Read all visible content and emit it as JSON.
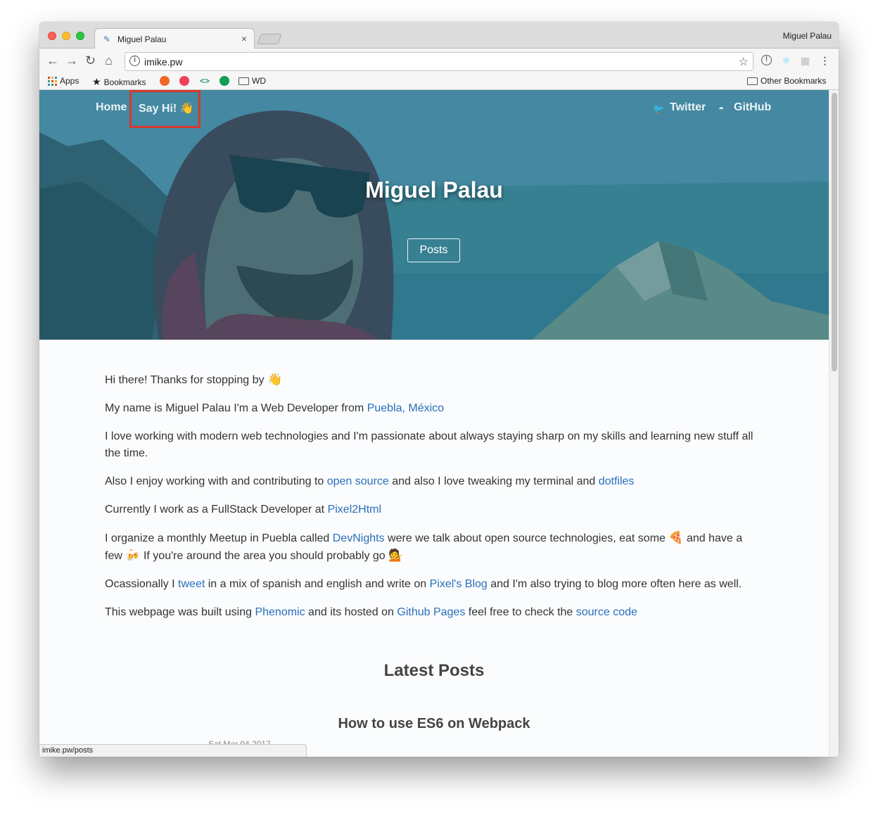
{
  "browser": {
    "tab_title": "Miguel Palau",
    "profile_name": "Miguel Palau",
    "url": "imike.pw",
    "status_url": "imike.pw/posts"
  },
  "bookmarks": {
    "apps_label": "Apps",
    "bookmarks_label": "Bookmarks",
    "wd_label": "WD",
    "other_label": "Other Bookmarks"
  },
  "nav": {
    "home": "Home",
    "say_hi": "Say Hi! 👋",
    "twitter": "Twitter",
    "github": "GitHub"
  },
  "hero": {
    "title": "Miguel Palau",
    "button": "Posts"
  },
  "about": {
    "p1": "Hi there! Thanks for stopping by",
    "p1_emoji": "👋",
    "p2_text": "My name is Miguel Palau I'm a Web Developer from ",
    "p2_link": "Puebla, México",
    "p3": "I love working with modern web technologies and I'm passionate about always staying sharp on my skills and learning new stuff all the time.",
    "p4_a": "Also I enjoy working with and contributing to ",
    "p4_link1": "open source",
    "p4_b": " and also I love tweaking my terminal and ",
    "p4_link2": "dotfiles",
    "p5_a": "Currently I work as a FullStack Developer at ",
    "p5_link": "Pixel2Html",
    "p6_a": "I organize a monthly Meetup in Puebla called ",
    "p6_link": "DevNights",
    "p6_b": " were we talk about open source technologies, eat some ",
    "p6_emoji1": "🍕",
    "p6_c": " and have a few ",
    "p6_emoji2": "🍻",
    "p6_d": " If you're around the area you should probably go ",
    "p6_emoji3": "💁",
    "p7_a": "Ocassionally I ",
    "p7_link1": "tweet",
    "p7_b": " in a mix of spanish and english and write on ",
    "p7_link2": "Pixel's Blog",
    "p7_c": " and I'm also trying to blog more often here as well.",
    "p8_a": "This webpage was built using ",
    "p8_link1": "Phenomic",
    "p8_b": " and its hosted on ",
    "p8_link2": "Github Pages",
    "p8_c": " feel free to check the ",
    "p8_link3": "source code"
  },
  "latest": {
    "heading": "Latest Posts",
    "post_title": "How to use ES6 on Webpack",
    "post_date": "Sat Mar 04 2017"
  },
  "colors": {
    "link": "#2a6fba",
    "highlight": "#d7382c",
    "hero_overlay": "#146e8c"
  }
}
